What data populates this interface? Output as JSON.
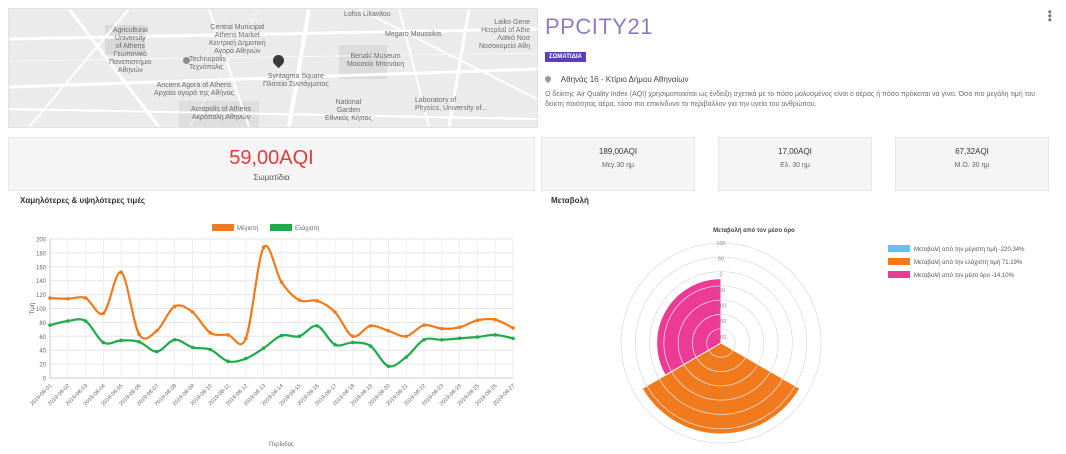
{
  "map": {
    "labels": {
      "agricultural": "Agricultural\nUniversity\nof Athens\nΓεωπονικό\nΠανεπιστήμιο\nΑθηνών",
      "market": "Central Municipal\nAthens Market\nΚεντρική Δημοτική\nΑγορά Αθηνών",
      "technopolis": "Technopolis\nΤεχνόπολις",
      "agora": "Ancient Agora of Athens\nΑρχαία αγορά της Αθήνας",
      "acropolis": "Acropolis of Athens\nΑκρόπολη Αθηνών",
      "lofos": "Lofos Likavitou",
      "megaro": "Megaro Moussikis",
      "laiko": "Laiko Gene\nHospital of Athe\nΛαϊκό Νοσ\nΝοσοκομείο Αθη",
      "benaki": "Benaki Museum\nΜουσείο Μπενάκη",
      "syntagma": "Syntagma Square\nΠλατεία Συντάγματος",
      "garden": "National\nGarden\nΕθνικός Κήπος",
      "physics": "Laboratory of\nPhysics, University of..."
    }
  },
  "header": {
    "title": "PPCITY21",
    "badge": "ΣΩΜΑΤΙΔΙΑ",
    "location": "Αθηνάς 16 - Κτίριο Δήμου Αθηναίων",
    "description": "Ο δείκτης Air Quality Index (AQI) χρησιμοποιείται ως ένδειξη σχετικά με το πόσο μολυσμένος είναι ο αέρας ή πόσο πρόκειται να γίνει. Όσο πιο μεγάλη τιμή του δείκτη ποιότητας αέρα, τόσο πιο επικίνδυνο το περιβάλλον για την υγεία του ανθρώπου."
  },
  "main_card": {
    "value": "59,00AQI",
    "label": "Σωματίδια"
  },
  "stats": [
    {
      "value": "189,00AQI",
      "label": "Μεγ.30 ημ"
    },
    {
      "value": "17,00AQI",
      "label": "Ελ. 30 ημ"
    },
    {
      "value": "67,32AQI",
      "label": "Μ.Ο. 30 ημ"
    }
  ],
  "sections": {
    "left": "Χαμηλότερες & υψηλότερες τιμές",
    "right": "Μεταβολή"
  },
  "colors": {
    "orange": "#f07a1c",
    "green": "#1faa4c",
    "blue": "#5ec4e8",
    "pink": "#ec3a96",
    "accent_title": "#8e7cc3",
    "badge": "#5b3fb8",
    "main_value": "#e03c3c"
  },
  "chart_data": [
    {
      "type": "line",
      "title": "",
      "xlabel": "Περίοδος",
      "ylabel": "Τιμή",
      "ylim": [
        0,
        200
      ],
      "yticks": [
        0,
        20,
        40,
        60,
        80,
        100,
        120,
        140,
        160,
        180,
        200
      ],
      "grid": true,
      "legend": "top-center",
      "x": [
        "2019-08-01",
        "2019-08-02",
        "2019-08-03",
        "2019-08-04",
        "2019-08-05",
        "2019-08-06",
        "2019-08-07",
        "2019-08-08",
        "2019-08-09",
        "2019-08-10",
        "2019-08-11",
        "2019-08-12",
        "2019-08-13",
        "2019-08-14",
        "2019-08-15",
        "2019-08-16",
        "2019-08-17",
        "2019-08-18",
        "2019-08-19",
        "2019-08-20",
        "2019-08-21",
        "2019-08-22",
        "2019-08-23",
        "2019-08-24",
        "2019-08-25",
        "2019-08-26",
        "2019-08-27"
      ],
      "series": [
        {
          "name": "Μέγιστη",
          "values": [
            115,
            114,
            115,
            93,
            152,
            63,
            68,
            103,
            95,
            65,
            62,
            57,
            188,
            138,
            112,
            111,
            95,
            60,
            75,
            68,
            60,
            76,
            71,
            73,
            83,
            84,
            72
          ]
        },
        {
          "name": "Ελάχιστη",
          "values": [
            76,
            82,
            82,
            51,
            54,
            52,
            38,
            55,
            44,
            41,
            24,
            28,
            43,
            61,
            60,
            75,
            48,
            51,
            46,
            17,
            30,
            55,
            55,
            57,
            59,
            62,
            57
          ]
        }
      ]
    },
    {
      "type": "polar-area",
      "title": "Μεταβολή από τον μέσο όρο",
      "rlim": [
        -220,
        100
      ],
      "rticks": [
        100,
        50,
        0,
        -50,
        -100,
        -150,
        -200
      ],
      "series": [
        {
          "name": "Μεταβολή από την μέγιστη τιμή",
          "value": -220.34,
          "legend_text": "Μεταβολή από την μέγιστη τιμή -220.34%"
        },
        {
          "name": "Μεταβολή από την ελάχιστη τιμή",
          "value": 71.19,
          "legend_text": "Μεταβολή από την ελάχιστη τιμή 71.19%"
        },
        {
          "name": "Μεταβολή από τον μέσο όρο",
          "value": -14.1,
          "legend_text": "Μεταβολή από τον μέσο όρο -14.10%"
        }
      ],
      "legend": "right"
    }
  ]
}
